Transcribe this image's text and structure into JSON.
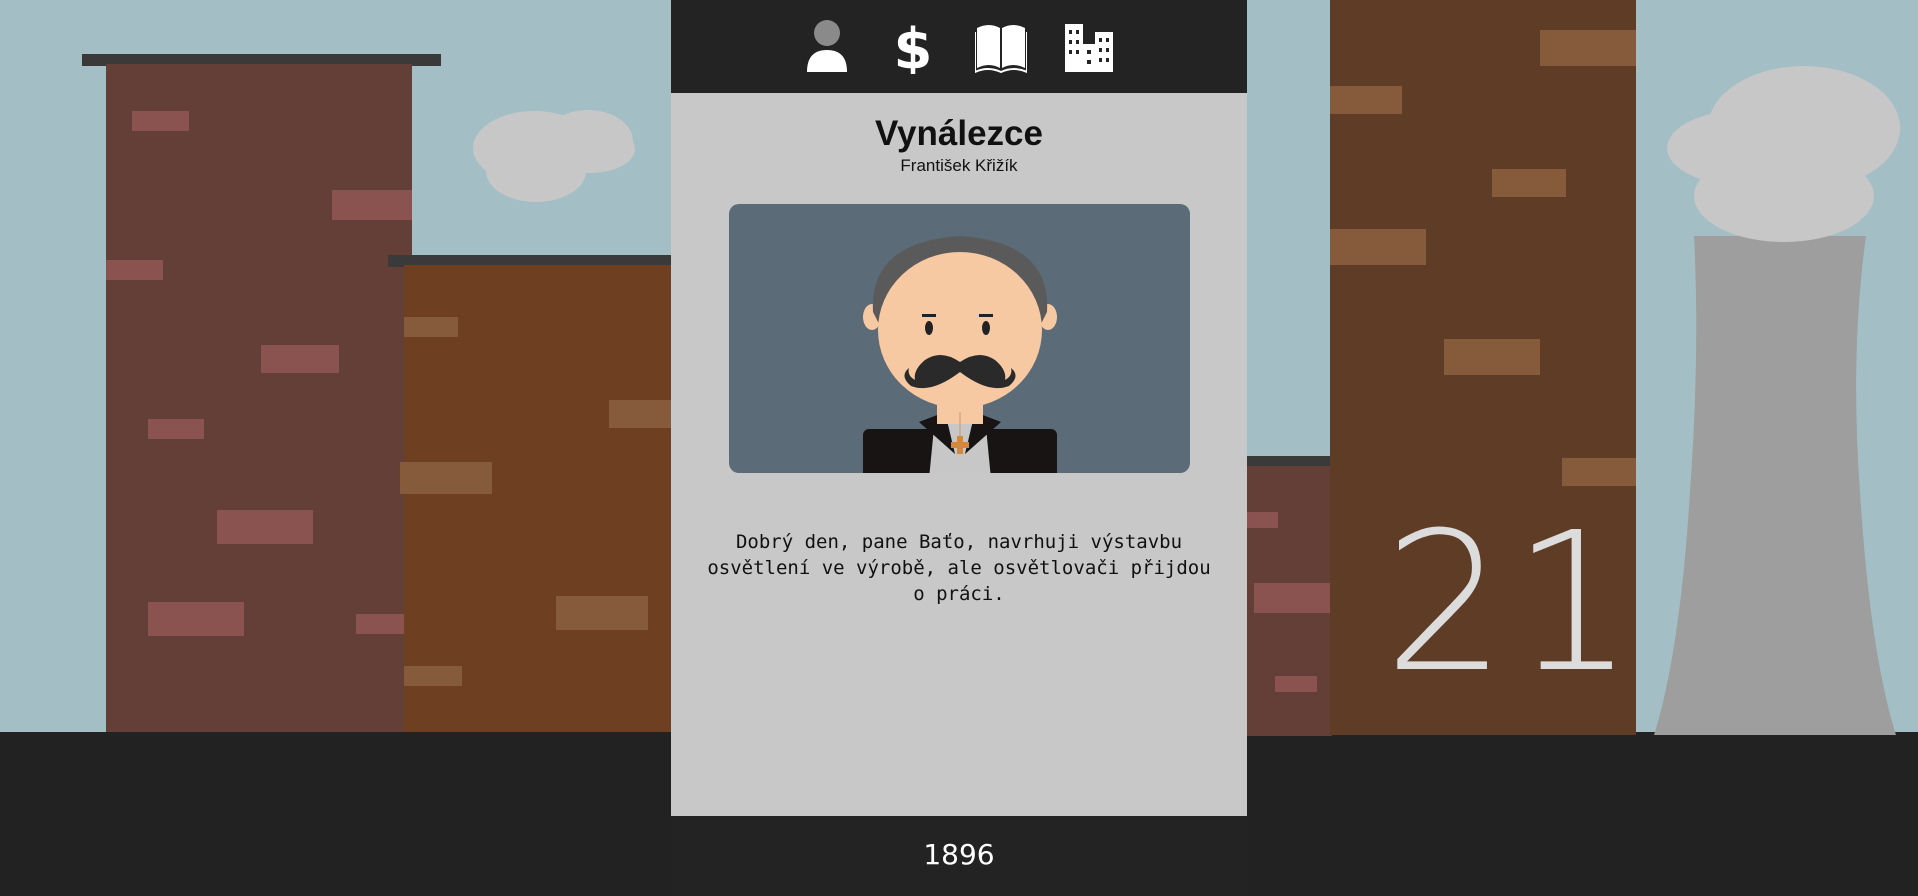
{
  "tabs": [
    {
      "name": "person",
      "icon": "person-icon"
    },
    {
      "name": "money",
      "icon": "dollar-icon"
    },
    {
      "name": "education",
      "icon": "book-icon"
    },
    {
      "name": "city",
      "icon": "city-icon"
    }
  ],
  "card": {
    "title": "Vynálezce",
    "subtitle": "František Křižík",
    "message": "Dobrý den, pane Baťo, navrhuji výstavbu osvětlení ve výrobě, ale osvětlovači přijdou o práci."
  },
  "year": "1896",
  "counter": "21",
  "colors": {
    "sky": "#a3bfc5",
    "ground": "#222222",
    "card": "#c8c8c8",
    "card_bar": "#232323",
    "portrait_bg": "#5b6b77"
  }
}
